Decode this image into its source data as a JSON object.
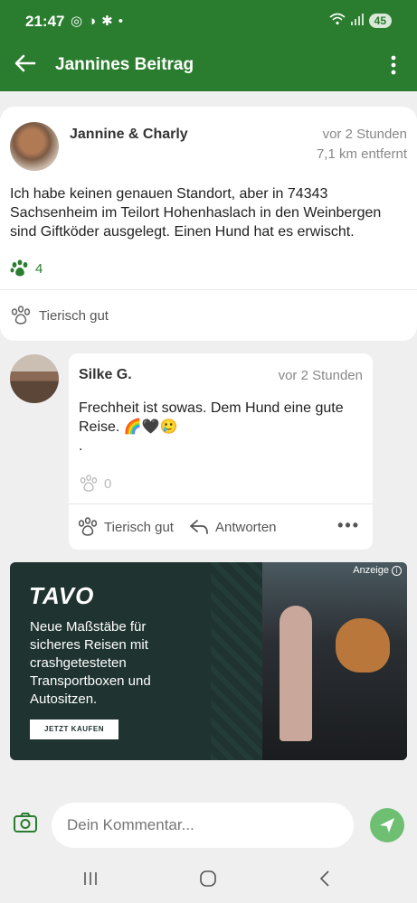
{
  "status": {
    "time": "21:47",
    "battery": "45"
  },
  "header": {
    "title": "Jannines Beitrag"
  },
  "post": {
    "author": "Jannine & Charly",
    "time": "vor 2 Stunden",
    "distance": "7,1 km entfernt",
    "text": "Ich habe keinen genauen Standort, aber in 74343 Sachsenheim im Teilort Hohenhaslach in den Weinbergen sind Giftköder ausgelegt. Einen Hund hat es erwischt.",
    "like_count": "4",
    "reaction_label": "Tierisch gut"
  },
  "comment": {
    "author": "Silke G.",
    "time": "vor 2 Stunden",
    "text": "Frechheit ist sowas. Dem Hund eine gute Reise. 🌈🖤🥲",
    "text_extra": ".",
    "like_count": "0",
    "reaction_label": "Tierisch gut",
    "reply_label": "Antworten"
  },
  "ad": {
    "brand": "TAVO",
    "headline": "Neue Maßstäbe für sicheres Reisen mit crashgetesteten Transportboxen und Autositzen.",
    "cta": "JETZT KAUFEN",
    "tag": "Anzeige"
  },
  "composer": {
    "placeholder": "Dein Kommentar..."
  },
  "colors": {
    "brand_green": "#2a7d2f",
    "send_green": "#6fbf73"
  }
}
